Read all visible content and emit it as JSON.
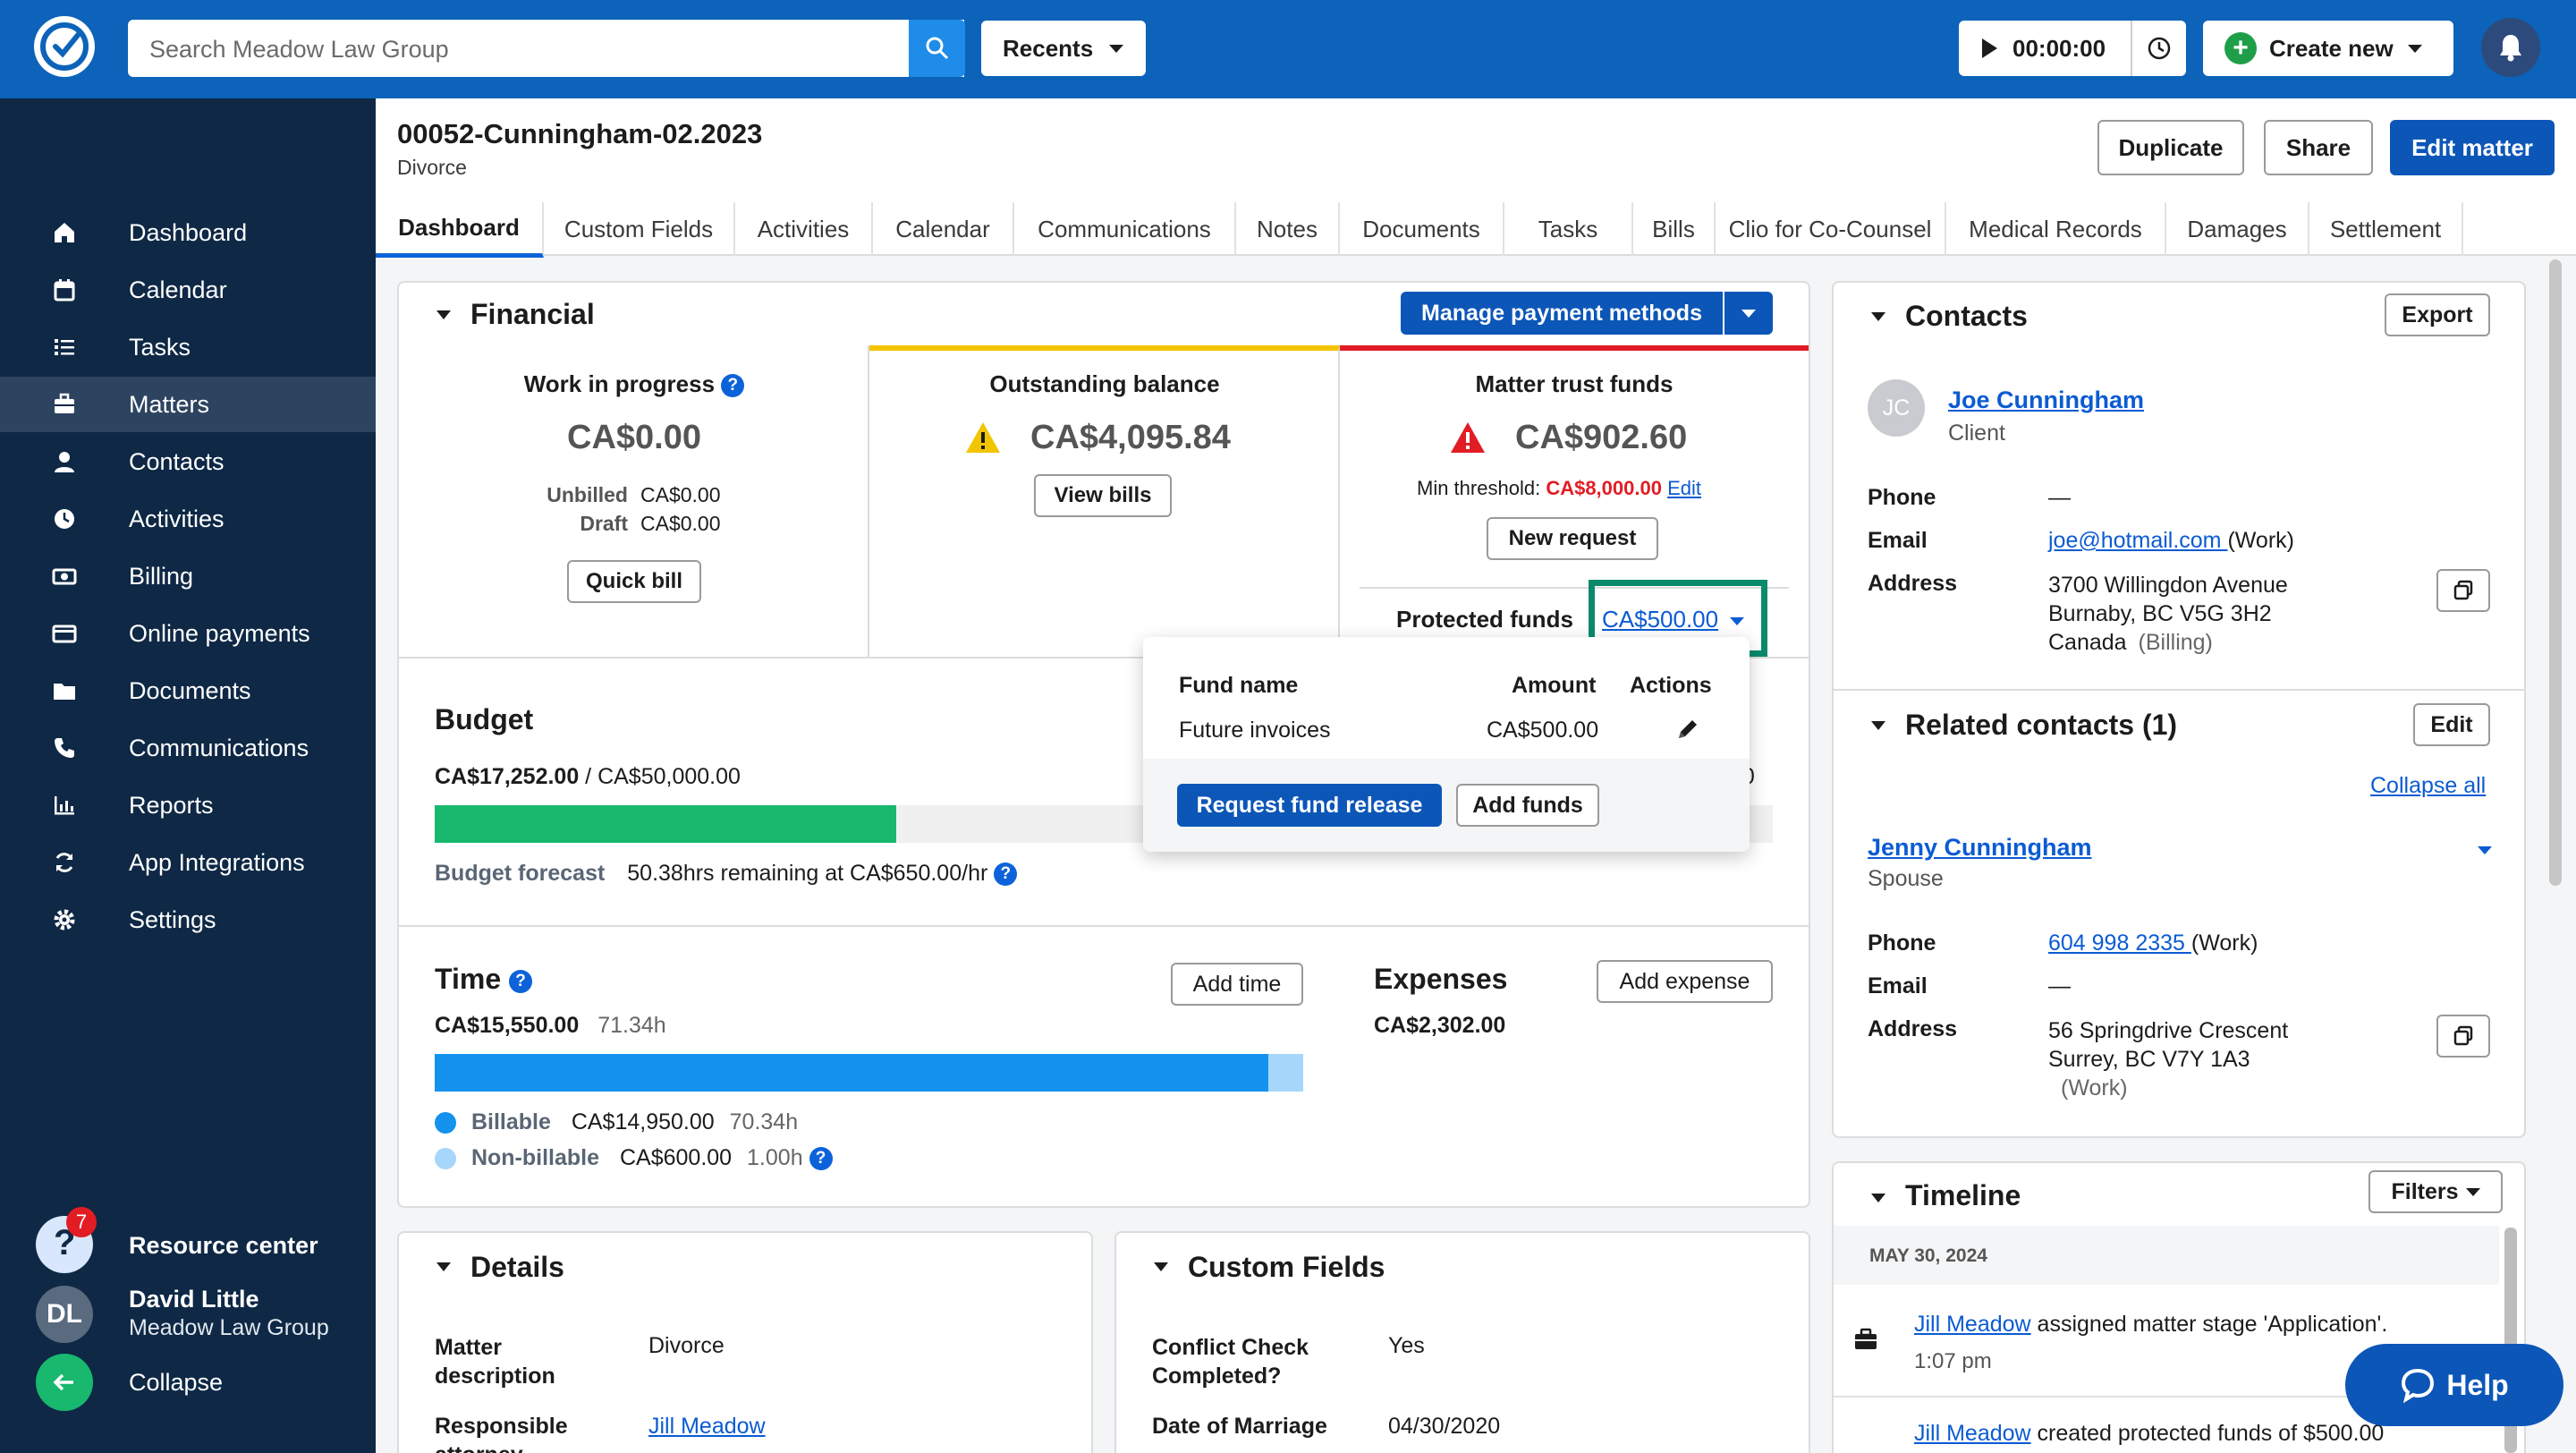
{
  "search": {
    "placeholder": "Search Meadow Law Group"
  },
  "topbar": {
    "recents": "Recents",
    "timer": "00:00:00",
    "create_new": "Create new"
  },
  "sidebar": {
    "items": [
      {
        "label": "Dashboard",
        "icon": "home-icon"
      },
      {
        "label": "Calendar",
        "icon": "calendar-icon"
      },
      {
        "label": "Tasks",
        "icon": "tasks-icon"
      },
      {
        "label": "Matters",
        "icon": "briefcase-icon"
      },
      {
        "label": "Contacts",
        "icon": "person-icon"
      },
      {
        "label": "Activities",
        "icon": "clock-icon"
      },
      {
        "label": "Billing",
        "icon": "billing-icon"
      },
      {
        "label": "Online payments",
        "icon": "card-icon"
      },
      {
        "label": "Documents",
        "icon": "folder-icon"
      },
      {
        "label": "Communications",
        "icon": "phone-icon"
      },
      {
        "label": "Reports",
        "icon": "chart-icon"
      },
      {
        "label": "App Integrations",
        "icon": "sync-icon"
      },
      {
        "label": "Settings",
        "icon": "gear-icon"
      }
    ],
    "resource_center": "Resource center",
    "resource_badge": "7",
    "user_initials": "DL",
    "user_name": "David Little",
    "user_firm": "Meadow Law Group",
    "collapse": "Collapse"
  },
  "matter": {
    "title": "00052-Cunningham-02.2023",
    "type": "Divorce"
  },
  "actions": {
    "duplicate": "Duplicate",
    "share": "Share",
    "edit": "Edit matter"
  },
  "tabs": [
    "Dashboard",
    "Custom Fields",
    "Activities",
    "Calendar",
    "Communications",
    "Notes",
    "Documents",
    "Tasks",
    "Bills",
    "Clio for Co-Counsel",
    "Medical Records",
    "Damages",
    "Settlement"
  ],
  "financial": {
    "title": "Financial",
    "manage": "Manage payment methods",
    "wip_label": "Work in progress",
    "wip_amount": "CA$0.00",
    "unbilled_label": "Unbilled",
    "unbilled_value": "CA$0.00",
    "draft_label": "Draft",
    "draft_value": "CA$0.00",
    "quick_bill": "Quick bill",
    "outstanding_label": "Outstanding balance",
    "outstanding_amount": "CA$4,095.84",
    "view_bills": "View bills",
    "trust_label": "Matter trust funds",
    "trust_amount": "CA$902.60",
    "min_threshold_label": "Min threshold:",
    "min_threshold_value": "CA$8,000.00",
    "edit": "Edit",
    "new_request": "New request",
    "protected_label": "Protected funds",
    "protected_value": "CA$500.00"
  },
  "popover": {
    "col_fund": "Fund name",
    "col_amount": "Amount",
    "col_actions": "Actions",
    "fund_name": "Future invoices",
    "fund_amount": "CA$500.00",
    "request_release": "Request fund release",
    "add_funds": "Add funds"
  },
  "budget": {
    "title": "Budget",
    "used": "CA$17,252.00",
    "total": " / CA$50,000.00",
    "partial": "00",
    "fill_fraction": 0.345,
    "forecast_label": "Budget forecast",
    "forecast_text": "50.38hrs remaining at CA$650.00/hr"
  },
  "time": {
    "title": "Time",
    "add": "Add time",
    "total": "CA$15,550.00",
    "hours": "71.34h",
    "billable_fraction": 0.96,
    "billable_label": "Billable",
    "billable_amount": "CA$14,950.00",
    "billable_hours": "70.34h",
    "nonbillable_label": "Non-billable",
    "nonbillable_amount": "CA$600.00",
    "nonbillable_hours": "1.00h"
  },
  "expenses": {
    "title": "Expenses",
    "add": "Add expense",
    "total": "CA$2,302.00"
  },
  "details": {
    "title": "Details",
    "desc_label": "Matter description",
    "desc_value": "Divorce",
    "resp_label": "Responsible attorney",
    "resp_value": "Jill Meadow"
  },
  "custom_fields": {
    "title": "Custom Fields",
    "conflict_label": "Conflict Check Completed?",
    "conflict_value": "Yes",
    "marriage_label": "Date of Marriage",
    "marriage_value": "04/30/2020"
  },
  "contacts": {
    "title": "Contacts",
    "export": "Export",
    "initials": "JC",
    "name": "Joe Cunningham",
    "role": "Client",
    "phone_label": "Phone",
    "phone_value": "—",
    "email_label": "Email",
    "email_value": "joe@hotmail.com ",
    "email_type": "(Work)",
    "address_label": "Address",
    "address_line1": "3700 Willingdon Avenue",
    "address_line2": "Burnaby, BC V5G 3H2",
    "address_line3": "Canada",
    "address_type": "(Billing)"
  },
  "related": {
    "title": "Related contacts (1)",
    "edit": "Edit",
    "collapse_all": "Collapse all",
    "name": "Jenny Cunningham",
    "role": "Spouse",
    "phone_label": "Phone",
    "phone_value": "604 998 2335 ",
    "phone_type": "(Work)",
    "email_label": "Email",
    "email_value": "—",
    "address_label": "Address",
    "address_line1": "56 Springdrive Crescent",
    "address_line2": "Surrey, BC V7Y 1A3",
    "address_type": "(Work)"
  },
  "timeline": {
    "title": "Timeline",
    "filters": "Filters",
    "date": "MAY 30, 2024",
    "event1_user": "Jill Meadow",
    "event1_text": " assigned matter stage 'Application'.",
    "event1_time": "1:07 pm",
    "event2_user": "Jill Meadow",
    "event2_text": " created protected funds of $500.00"
  },
  "help": "Help",
  "colors": {
    "brand": "#0c63b9",
    "sidebar": "#0e2845",
    "primary": "#0c56b8",
    "warning": "#f2c500",
    "danger": "#e21c24",
    "green": "#18b86e",
    "blue_bar": "#1492ee",
    "highlight": "#0a8a6b"
  }
}
